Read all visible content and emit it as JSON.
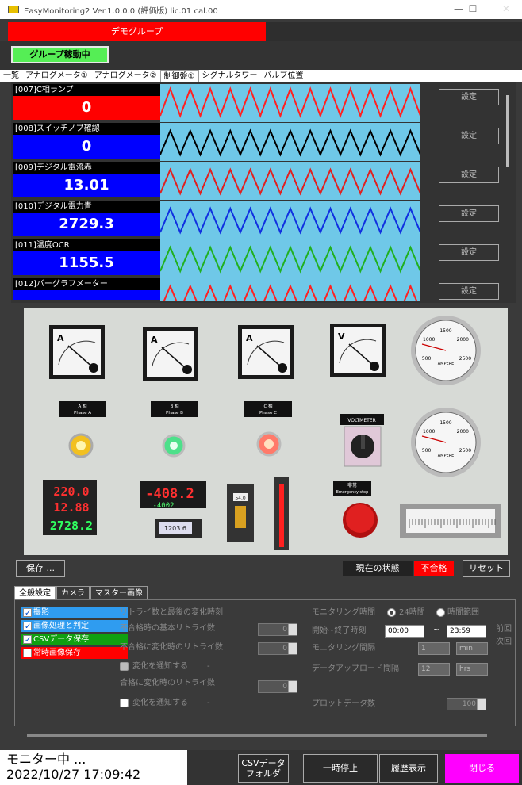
{
  "window": {
    "title": "EasyMonitoring2 Ver.1.0.0.0 (評価版)  lic.01 cal.00",
    "minimize": "—",
    "maximize": "☐",
    "close": "✕"
  },
  "group": {
    "name": "デモグループ",
    "status": "グループ稼動中"
  },
  "tabs": [
    "一覧",
    "アナログメータ①",
    "アナログメータ②",
    "制御盤①",
    "シグナルタワー",
    "バルブ位置"
  ],
  "active_tab_index": 3,
  "channels": [
    {
      "label": "[007]C相ランプ",
      "value": "0",
      "bg": "#ff0000",
      "wave_color": "#ff2020",
      "setting": "設定"
    },
    {
      "label": "[008]スイッチノブ確認",
      "value": "0",
      "bg": "#0000ff",
      "wave_color": "#000000",
      "setting": "設定"
    },
    {
      "label": "[009]デジタル電流赤",
      "value": "13.01",
      "bg": "#0000ff",
      "wave_color": "#e02020",
      "setting": "設定"
    },
    {
      "label": "[010]デジタル電力青",
      "value": "2729.3",
      "bg": "#0000ff",
      "wave_color": "#1030e0",
      "setting": "設定"
    },
    {
      "label": "[011]温度OCR",
      "value": "1155.5",
      "bg": "#0000ff",
      "wave_color": "#20b020",
      "setting": "設定"
    },
    {
      "label": "[012]バーグラフメーター",
      "value": "",
      "bg": "#0000ff",
      "wave_color": "#ff2020",
      "setting": "設定"
    }
  ],
  "panel": {
    "plates": [
      "A 相\nPhase A",
      "B 相\nPhase B",
      "C 相\nPhase C"
    ],
    "switch_label": "VOLTMETER",
    "estop_label": "非常\nEmergency stop",
    "digital": {
      "red_top": "220.0",
      "red_mid": "12.88",
      "green_bot": "2728.2",
      "red_big": "-408.2",
      "green_small": "-4002",
      "small_meter": "1203.6",
      "bar_top": "54.0"
    },
    "meter_letters": [
      "A",
      "A",
      "A",
      "V"
    ],
    "round_meter_label": "AMPERE"
  },
  "actions": {
    "save": "保存 ...",
    "state_label": "現在の状態",
    "state_value": "不合格",
    "reset": "リセット"
  },
  "bottom_tabs": [
    "全般設定",
    "カメラ",
    "マスター画像"
  ],
  "settings": {
    "checks": [
      {
        "label": "撮影",
        "color": "#2f9cf0",
        "checked": true
      },
      {
        "label": "画像処理と判定",
        "color": "#2f9cf0",
        "checked": true
      },
      {
        "label": "CSVデータ保存",
        "color": "#10a010",
        "checked": true
      },
      {
        "label": "常時画像保存",
        "color": "#ff0000",
        "checked": false
      }
    ],
    "mid_labels": [
      "リトライ数と最後の変化時刻",
      "不合格時の基本リトライ数",
      "不合格に変化時のリトライ数",
      "変化を通知する",
      "合格に変化時のリトライ数",
      "変化を通知する"
    ],
    "spin_values": [
      "0",
      "0",
      "0"
    ],
    "dash": "-",
    "right_labels": [
      "モニタリング時間",
      "開始~終了時刻",
      "モニタリング間隔",
      "データアップロード間隔",
      "プロットデータ数"
    ],
    "radio1": "24時間",
    "radio2": "時間範囲",
    "start_time": "00:00",
    "end_time": "23:59",
    "tilde": "~",
    "interval_val": "1",
    "interval_unit": "min",
    "upload_val": "12",
    "upload_unit": "hrs",
    "plot_count": "100",
    "cut_labels": [
      "前回",
      "次回"
    ]
  },
  "status": {
    "text": "モニター中 ...",
    "time": "2022/10/27 17:09:42"
  },
  "buttons": {
    "csv": "CSVデータ\nフォルダ",
    "pause": "一時停止",
    "history": "履歴表示",
    "close": "閉じる"
  }
}
